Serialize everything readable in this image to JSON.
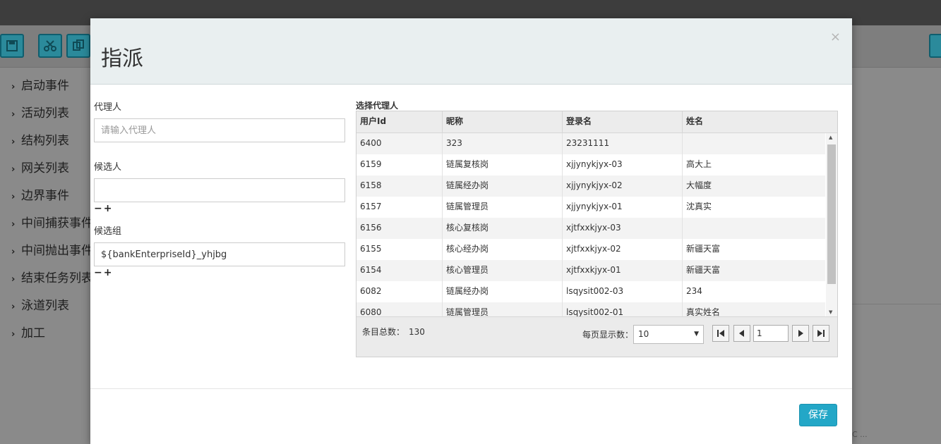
{
  "background": {
    "sidebar_items": [
      "启动事件",
      "活动列表",
      "结构列表",
      "网关列表",
      "边界事件",
      "中间捕获事件",
      "中间抛出事件",
      "结束任务列表",
      "泳道列表",
      "加工"
    ],
    "corner_text": "C ..."
  },
  "modal": {
    "title": "指派",
    "close": "×",
    "assignee": {
      "label": "代理人",
      "placeholder": "请输入代理人",
      "value": ""
    },
    "candidate_users": {
      "label": "候选人",
      "value": ""
    },
    "candidate_groups": {
      "label": "候选组",
      "value": "${bankEnterpriseId}_yhjbg"
    },
    "minus": "−",
    "plus": "+",
    "grid": {
      "label": "选择代理人",
      "columns": [
        "用户Id",
        "昵称",
        "登录名",
        "姓名"
      ],
      "rows": [
        [
          "6400",
          "323",
          "23231111",
          ""
        ],
        [
          "6159",
          "链属复核岗",
          "xjjynykjyx-03",
          "高大上"
        ],
        [
          "6158",
          "链属经办岗",
          "xjjynykjyx-02",
          "大幅度"
        ],
        [
          "6157",
          "链属管理员",
          "xjjynykjyx-01",
          "沈真实"
        ],
        [
          "6156",
          "核心复核岗",
          "xjtfxxkjyx-03",
          ""
        ],
        [
          "6155",
          "核心经办岗",
          "xjtfxxkjyx-02",
          "新疆天富"
        ],
        [
          "6154",
          "核心管理员",
          "xjtfxxkjyx-01",
          "新疆天富"
        ],
        [
          "6082",
          "链属经办岗",
          "lsqysit002-03",
          "234"
        ],
        [
          "6080",
          "链属管理员",
          "lsqysit002-01",
          "真实姓名"
        ]
      ],
      "total_label": "条目总数：",
      "total": "130",
      "page_size_label": "每页显示数：",
      "page_size": "10",
      "page": "1"
    },
    "save_label": "保存"
  },
  "colors": {
    "accent": "#23a7c7",
    "header_bg": "#e9eff0"
  }
}
